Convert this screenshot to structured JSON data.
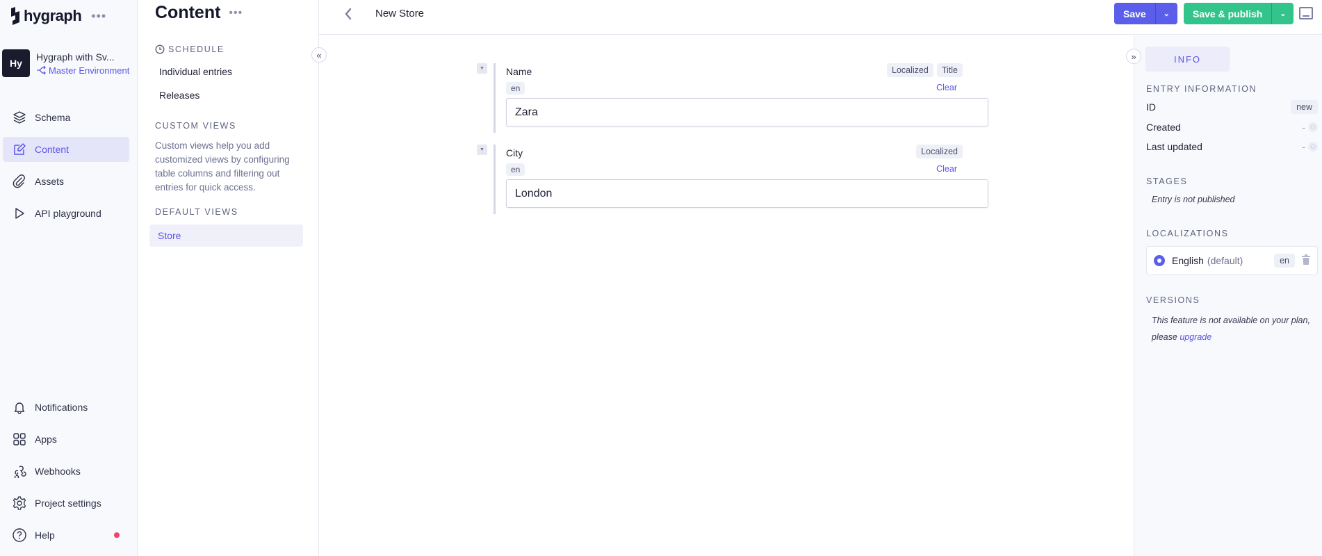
{
  "nav": {
    "logo": "hygraph",
    "project": {
      "avatar": "Hy",
      "name": "Hygraph with Sv...",
      "environment": "Master Environment"
    },
    "items": [
      {
        "label": "Schema",
        "icon": "layers-icon"
      },
      {
        "label": "Content",
        "icon": "edit-icon",
        "active": true
      },
      {
        "label": "Assets",
        "icon": "paperclip-icon"
      },
      {
        "label": "API playground",
        "icon": "play-icon"
      }
    ],
    "bottom_items": [
      {
        "label": "Notifications",
        "icon": "bell-icon"
      },
      {
        "label": "Apps",
        "icon": "grid-icon"
      },
      {
        "label": "Webhooks",
        "icon": "webhook-icon"
      },
      {
        "label": "Project settings",
        "icon": "gear-icon"
      },
      {
        "label": "Help",
        "icon": "help-icon"
      }
    ]
  },
  "content_sidebar": {
    "title": "Content",
    "schedule_heading": "SCHEDULE",
    "schedule_links": [
      "Individual entries",
      "Releases"
    ],
    "custom_views_heading": "CUSTOM VIEWS",
    "custom_views_desc": "Custom views help you add customized views by configuring table columns and filtering out entries for quick access.",
    "default_views_heading": "DEFAULT VIEWS",
    "default_views": [
      "Store"
    ]
  },
  "header": {
    "title": "New Store",
    "save_label": "Save",
    "publish_label": "Save & publish"
  },
  "fields": [
    {
      "label": "Name",
      "locale": "en",
      "tags": [
        "Localized",
        "Title"
      ],
      "clear": "Clear",
      "value": "Zara"
    },
    {
      "label": "City",
      "locale": "en",
      "tags": [
        "Localized"
      ],
      "clear": "Clear",
      "value": "London"
    }
  ],
  "info_panel": {
    "tab": "INFO",
    "entry_info_heading": "ENTRY INFORMATION",
    "id_label": "ID",
    "id_value": "new",
    "created_label": "Created",
    "created_value": "-",
    "updated_label": "Last updated",
    "updated_value": "-",
    "stages_heading": "STAGES",
    "stages_text": "Entry is not published",
    "localizations_heading": "LOCALIZATIONS",
    "localization": {
      "name": "English",
      "default": "(default)",
      "code": "en"
    },
    "versions_heading": "VERSIONS",
    "versions_text": "This feature is not available on your plan,",
    "versions_text2": "please",
    "upgrade_link": "upgrade"
  },
  "colors": {
    "accent": "#5b5eea",
    "publish": "#33c48c",
    "help_dot": "#f2426e"
  }
}
